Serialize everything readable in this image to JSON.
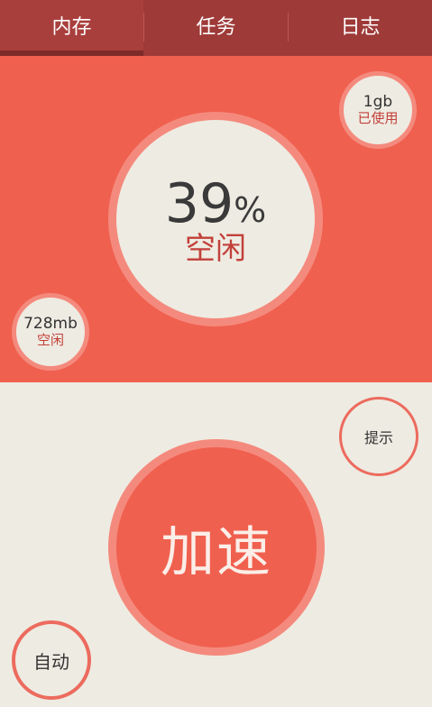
{
  "tabs": [
    {
      "label": "内存",
      "active": true
    },
    {
      "label": "任务",
      "active": false
    },
    {
      "label": "日志",
      "active": false
    }
  ],
  "memory": {
    "used_value": "1gb",
    "used_label": "已使用",
    "free_percent": "39",
    "percent_sign": "%",
    "free_percent_label": "空闲",
    "free_value": "728mb",
    "free_label": "空闲"
  },
  "actions": {
    "hint_label": "提示",
    "accelerate_label": "加速",
    "auto_label": "自动"
  },
  "colors": {
    "tabbar": "#9e3a38",
    "panel": "#f0604f",
    "ring": "#f48a7d",
    "background": "#eeebe2",
    "accent_text": "#c2403a"
  }
}
